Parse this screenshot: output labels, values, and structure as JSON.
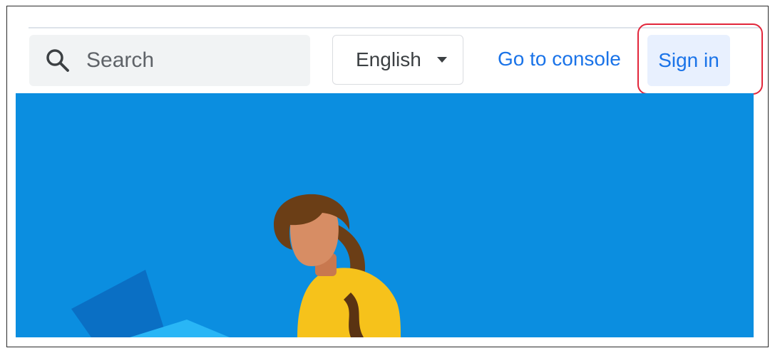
{
  "header": {
    "search": {
      "placeholder": "Search",
      "icon": "search-icon"
    },
    "language": {
      "selected": "English",
      "icon": "caret-down-icon"
    },
    "console_link": "Go to console",
    "sign_in_button": "Sign in"
  },
  "colors": {
    "accent": "#1a73e8",
    "hero_background": "#0b8ee0",
    "highlight": "#e2263b"
  }
}
